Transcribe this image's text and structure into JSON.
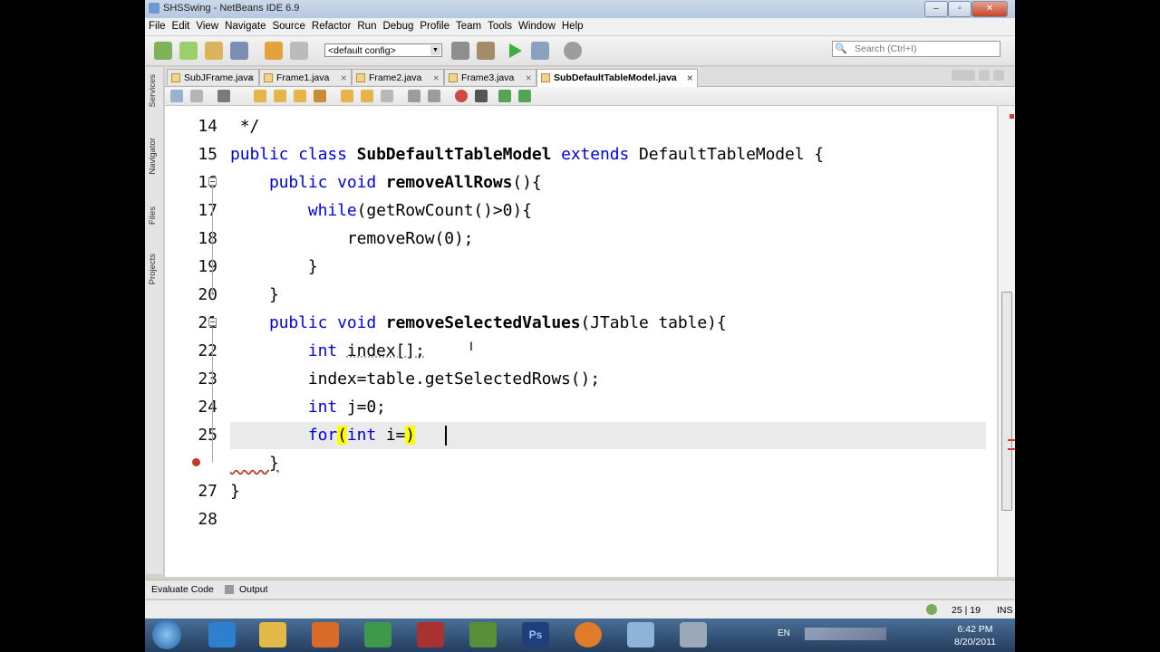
{
  "window": {
    "title": "SHSSwing - NetBeans IDE 6.9"
  },
  "menu": [
    "File",
    "Edit",
    "View",
    "Navigate",
    "Source",
    "Refactor",
    "Run",
    "Debug",
    "Profile",
    "Team",
    "Tools",
    "Window",
    "Help"
  ],
  "toolbar": {
    "config": "<default config>",
    "search_placeholder": "Search (Ctrl+I)"
  },
  "side_panels": [
    "Services",
    "Navigator",
    "Files",
    "Projects"
  ],
  "tabs": [
    {
      "label": "SubJFrame.java"
    },
    {
      "label": "Frame1.java"
    },
    {
      "label": "Frame2.java"
    },
    {
      "label": "Frame3.java"
    },
    {
      "label": "SubDefaultTableModel.java",
      "active": true
    }
  ],
  "editor": {
    "line_numbers": [
      "14",
      "15",
      "16",
      "17",
      "18",
      "19",
      "20",
      "21",
      "22",
      "23",
      "24",
      "25",
      "",
      "27",
      "28"
    ],
    "code": {
      "l14": " */",
      "l15a": "public class ",
      "l15b": "SubDefaultTableModel",
      "l15c": " extends ",
      "l15d": "DefaultTableModel {",
      "l16a": "    public void ",
      "l16b": "removeAllRows",
      "l16c": "(){",
      "l17a": "        while",
      "l17b": "(getRowCount()>0){",
      "l18": "            removeRow(0);",
      "l19": "        }",
      "l20": "    }",
      "l21a": "    public void ",
      "l21b": "removeSelectedValues",
      "l21c": "(JTable table){",
      "l22a": "        int ",
      "l22b": "index[];",
      "l23": "        index=table.getSelectedRows();",
      "l24a": "        int ",
      "l24b": "j=0;",
      "l25a": "        for",
      "l25b": "(",
      "l25c": "int",
      "l25d": " i=",
      "l25e": ")",
      "l26": "    }",
      "l27": "}"
    }
  },
  "bottom_tabs": {
    "evaluate": "Evaluate Code",
    "output": "Output"
  },
  "status": {
    "position": "25 | 19",
    "mode": "INS"
  },
  "taskbar": {
    "lang": "EN",
    "time": "6:42 PM",
    "date": "8/20/2011"
  },
  "colors": {
    "keyword": "#0000e6",
    "current_line": "#eaeaea",
    "brace_match": "#ffff00",
    "taskbar": "#2d4a6e"
  }
}
